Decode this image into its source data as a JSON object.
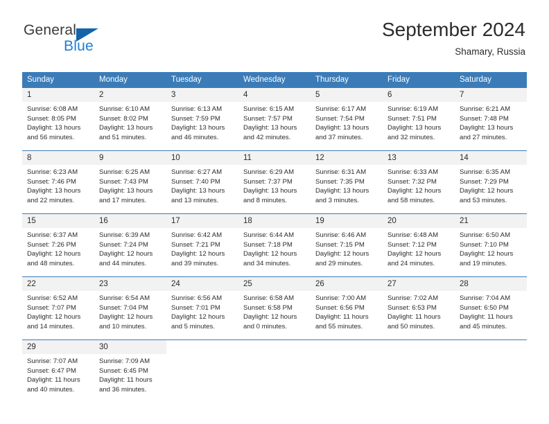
{
  "logo": {
    "word1": "General",
    "word2": "Blue",
    "triangle_color": "#1464aa",
    "blue_color": "#1c7fd4"
  },
  "header": {
    "title": "September 2024",
    "subtitle": "Shamary, Russia"
  },
  "theme": {
    "header_bg": "#3b7cb8",
    "daynum_bg": "#f2f2f2",
    "text": "#2b2b2b"
  },
  "weekday_headers": [
    "Sunday",
    "Monday",
    "Tuesday",
    "Wednesday",
    "Thursday",
    "Friday",
    "Saturday"
  ],
  "weeks": [
    [
      {
        "day": "1",
        "sunrise": "Sunrise: 6:08 AM",
        "sunset": "Sunset: 8:05 PM",
        "daylight1": "Daylight: 13 hours",
        "daylight2": "and 56 minutes."
      },
      {
        "day": "2",
        "sunrise": "Sunrise: 6:10 AM",
        "sunset": "Sunset: 8:02 PM",
        "daylight1": "Daylight: 13 hours",
        "daylight2": "and 51 minutes."
      },
      {
        "day": "3",
        "sunrise": "Sunrise: 6:13 AM",
        "sunset": "Sunset: 7:59 PM",
        "daylight1": "Daylight: 13 hours",
        "daylight2": "and 46 minutes."
      },
      {
        "day": "4",
        "sunrise": "Sunrise: 6:15 AM",
        "sunset": "Sunset: 7:57 PM",
        "daylight1": "Daylight: 13 hours",
        "daylight2": "and 42 minutes."
      },
      {
        "day": "5",
        "sunrise": "Sunrise: 6:17 AM",
        "sunset": "Sunset: 7:54 PM",
        "daylight1": "Daylight: 13 hours",
        "daylight2": "and 37 minutes."
      },
      {
        "day": "6",
        "sunrise": "Sunrise: 6:19 AM",
        "sunset": "Sunset: 7:51 PM",
        "daylight1": "Daylight: 13 hours",
        "daylight2": "and 32 minutes."
      },
      {
        "day": "7",
        "sunrise": "Sunrise: 6:21 AM",
        "sunset": "Sunset: 7:48 PM",
        "daylight1": "Daylight: 13 hours",
        "daylight2": "and 27 minutes."
      }
    ],
    [
      {
        "day": "8",
        "sunrise": "Sunrise: 6:23 AM",
        "sunset": "Sunset: 7:46 PM",
        "daylight1": "Daylight: 13 hours",
        "daylight2": "and 22 minutes."
      },
      {
        "day": "9",
        "sunrise": "Sunrise: 6:25 AM",
        "sunset": "Sunset: 7:43 PM",
        "daylight1": "Daylight: 13 hours",
        "daylight2": "and 17 minutes."
      },
      {
        "day": "10",
        "sunrise": "Sunrise: 6:27 AM",
        "sunset": "Sunset: 7:40 PM",
        "daylight1": "Daylight: 13 hours",
        "daylight2": "and 13 minutes."
      },
      {
        "day": "11",
        "sunrise": "Sunrise: 6:29 AM",
        "sunset": "Sunset: 7:37 PM",
        "daylight1": "Daylight: 13 hours",
        "daylight2": "and 8 minutes."
      },
      {
        "day": "12",
        "sunrise": "Sunrise: 6:31 AM",
        "sunset": "Sunset: 7:35 PM",
        "daylight1": "Daylight: 13 hours",
        "daylight2": "and 3 minutes."
      },
      {
        "day": "13",
        "sunrise": "Sunrise: 6:33 AM",
        "sunset": "Sunset: 7:32 PM",
        "daylight1": "Daylight: 12 hours",
        "daylight2": "and 58 minutes."
      },
      {
        "day": "14",
        "sunrise": "Sunrise: 6:35 AM",
        "sunset": "Sunset: 7:29 PM",
        "daylight1": "Daylight: 12 hours",
        "daylight2": "and 53 minutes."
      }
    ],
    [
      {
        "day": "15",
        "sunrise": "Sunrise: 6:37 AM",
        "sunset": "Sunset: 7:26 PM",
        "daylight1": "Daylight: 12 hours",
        "daylight2": "and 48 minutes."
      },
      {
        "day": "16",
        "sunrise": "Sunrise: 6:39 AM",
        "sunset": "Sunset: 7:24 PM",
        "daylight1": "Daylight: 12 hours",
        "daylight2": "and 44 minutes."
      },
      {
        "day": "17",
        "sunrise": "Sunrise: 6:42 AM",
        "sunset": "Sunset: 7:21 PM",
        "daylight1": "Daylight: 12 hours",
        "daylight2": "and 39 minutes."
      },
      {
        "day": "18",
        "sunrise": "Sunrise: 6:44 AM",
        "sunset": "Sunset: 7:18 PM",
        "daylight1": "Daylight: 12 hours",
        "daylight2": "and 34 minutes."
      },
      {
        "day": "19",
        "sunrise": "Sunrise: 6:46 AM",
        "sunset": "Sunset: 7:15 PM",
        "daylight1": "Daylight: 12 hours",
        "daylight2": "and 29 minutes."
      },
      {
        "day": "20",
        "sunrise": "Sunrise: 6:48 AM",
        "sunset": "Sunset: 7:12 PM",
        "daylight1": "Daylight: 12 hours",
        "daylight2": "and 24 minutes."
      },
      {
        "day": "21",
        "sunrise": "Sunrise: 6:50 AM",
        "sunset": "Sunset: 7:10 PM",
        "daylight1": "Daylight: 12 hours",
        "daylight2": "and 19 minutes."
      }
    ],
    [
      {
        "day": "22",
        "sunrise": "Sunrise: 6:52 AM",
        "sunset": "Sunset: 7:07 PM",
        "daylight1": "Daylight: 12 hours",
        "daylight2": "and 14 minutes."
      },
      {
        "day": "23",
        "sunrise": "Sunrise: 6:54 AM",
        "sunset": "Sunset: 7:04 PM",
        "daylight1": "Daylight: 12 hours",
        "daylight2": "and 10 minutes."
      },
      {
        "day": "24",
        "sunrise": "Sunrise: 6:56 AM",
        "sunset": "Sunset: 7:01 PM",
        "daylight1": "Daylight: 12 hours",
        "daylight2": "and 5 minutes."
      },
      {
        "day": "25",
        "sunrise": "Sunrise: 6:58 AM",
        "sunset": "Sunset: 6:58 PM",
        "daylight1": "Daylight: 12 hours",
        "daylight2": "and 0 minutes."
      },
      {
        "day": "26",
        "sunrise": "Sunrise: 7:00 AM",
        "sunset": "Sunset: 6:56 PM",
        "daylight1": "Daylight: 11 hours",
        "daylight2": "and 55 minutes."
      },
      {
        "day": "27",
        "sunrise": "Sunrise: 7:02 AM",
        "sunset": "Sunset: 6:53 PM",
        "daylight1": "Daylight: 11 hours",
        "daylight2": "and 50 minutes."
      },
      {
        "day": "28",
        "sunrise": "Sunrise: 7:04 AM",
        "sunset": "Sunset: 6:50 PM",
        "daylight1": "Daylight: 11 hours",
        "daylight2": "and 45 minutes."
      }
    ],
    [
      {
        "day": "29",
        "sunrise": "Sunrise: 7:07 AM",
        "sunset": "Sunset: 6:47 PM",
        "daylight1": "Daylight: 11 hours",
        "daylight2": "and 40 minutes."
      },
      {
        "day": "30",
        "sunrise": "Sunrise: 7:09 AM",
        "sunset": "Sunset: 6:45 PM",
        "daylight1": "Daylight: 11 hours",
        "daylight2": "and 36 minutes."
      },
      {
        "day": "",
        "sunrise": "",
        "sunset": "",
        "daylight1": "",
        "daylight2": ""
      },
      {
        "day": "",
        "sunrise": "",
        "sunset": "",
        "daylight1": "",
        "daylight2": ""
      },
      {
        "day": "",
        "sunrise": "",
        "sunset": "",
        "daylight1": "",
        "daylight2": ""
      },
      {
        "day": "",
        "sunrise": "",
        "sunset": "",
        "daylight1": "",
        "daylight2": ""
      },
      {
        "day": "",
        "sunrise": "",
        "sunset": "",
        "daylight1": "",
        "daylight2": ""
      }
    ]
  ]
}
